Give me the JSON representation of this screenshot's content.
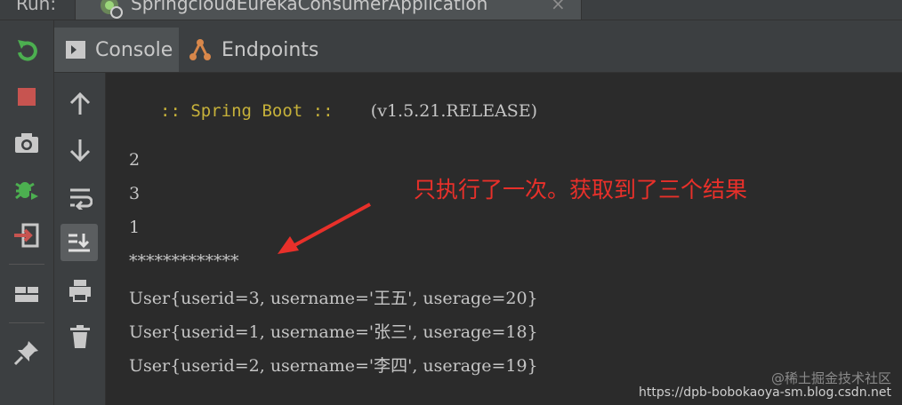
{
  "run_bar": {
    "label": "Run:",
    "tab_title": "SpringcloudEurekaConsumerApplication",
    "close_glyph": "×"
  },
  "tabs": [
    {
      "label": "Console",
      "icon": "console-icon",
      "active": true
    },
    {
      "label": "Endpoints",
      "icon": "endpoints-icon",
      "active": false
    }
  ],
  "left_toolbar": [
    "rerun-icon",
    "stop-icon",
    "camera-icon",
    "debug-icon",
    "exit-icon",
    "layout-icon",
    "pin-icon"
  ],
  "console_toolbar": [
    "up-arrow-icon",
    "down-arrow-icon",
    "soft-wrap-icon",
    "scroll-to-end-icon",
    "print-icon",
    "trash-icon"
  ],
  "console": {
    "banner": "  :: Spring Boot ::",
    "banner_version": "(v1.5.21.RELEASE)",
    "lines": [
      "2",
      "3",
      "1",
      "*************",
      "User{userid=3, username='王五', userage=20}",
      "User{userid=1, username='张三', userage=18}",
      "User{userid=2, username='李四', userage=19}"
    ]
  },
  "annotation": "只执行了一次。获取到了三个结果",
  "watermark": {
    "line1": "@稀土掘金技术社区",
    "line2": "https://dpb-bobokaoya-sm.blog.csdn.net"
  },
  "colors": {
    "background": "#2b2b2b",
    "toolbar": "#3c3f41",
    "banner": "#c6b13a",
    "annotation": "#e8302a",
    "rerun_green": "#4caf50",
    "stop_red": "#c75450"
  }
}
